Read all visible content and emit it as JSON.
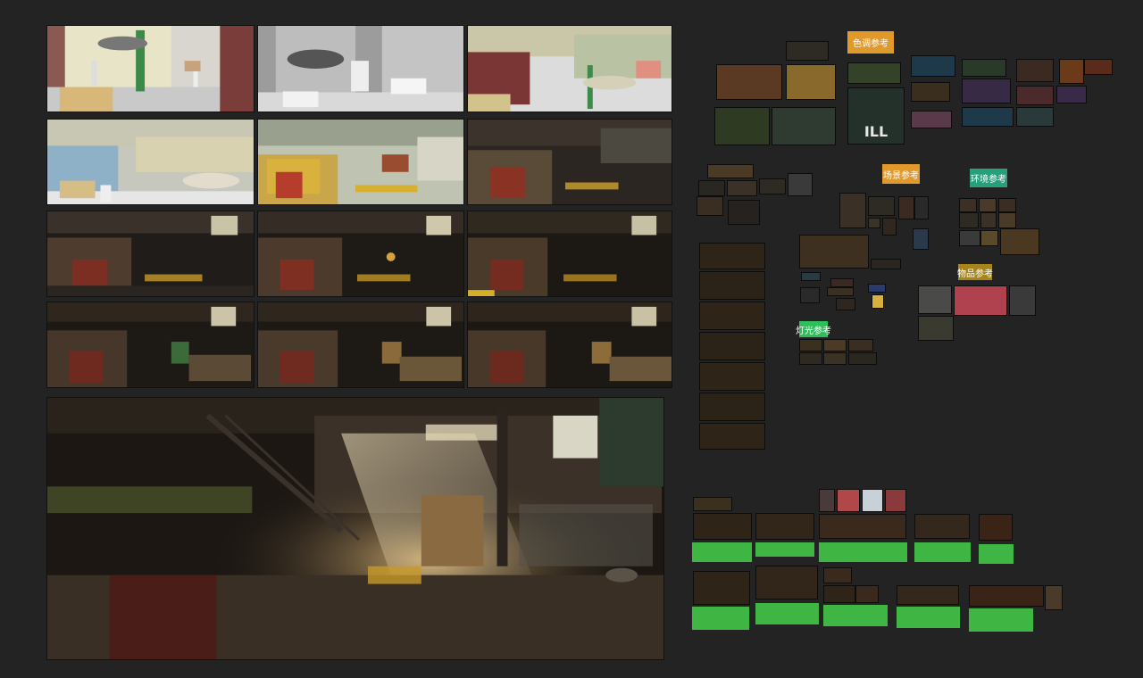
{
  "colors": {
    "background": "#232323",
    "tag_orange": "#e09a2c",
    "tag_teal": "#25a07a",
    "tag_olive": "#a8851c",
    "tag_green": "#2fbf5a",
    "note_green": "#3fb544"
  },
  "ref_labels": {
    "color_ref": "色调参考",
    "scene_ref": "场景参考",
    "env_ref": "环境参考",
    "prop_ref": "物品参考",
    "light_ref": "灯光参考"
  },
  "big_text": {
    "ill": "ILL"
  }
}
